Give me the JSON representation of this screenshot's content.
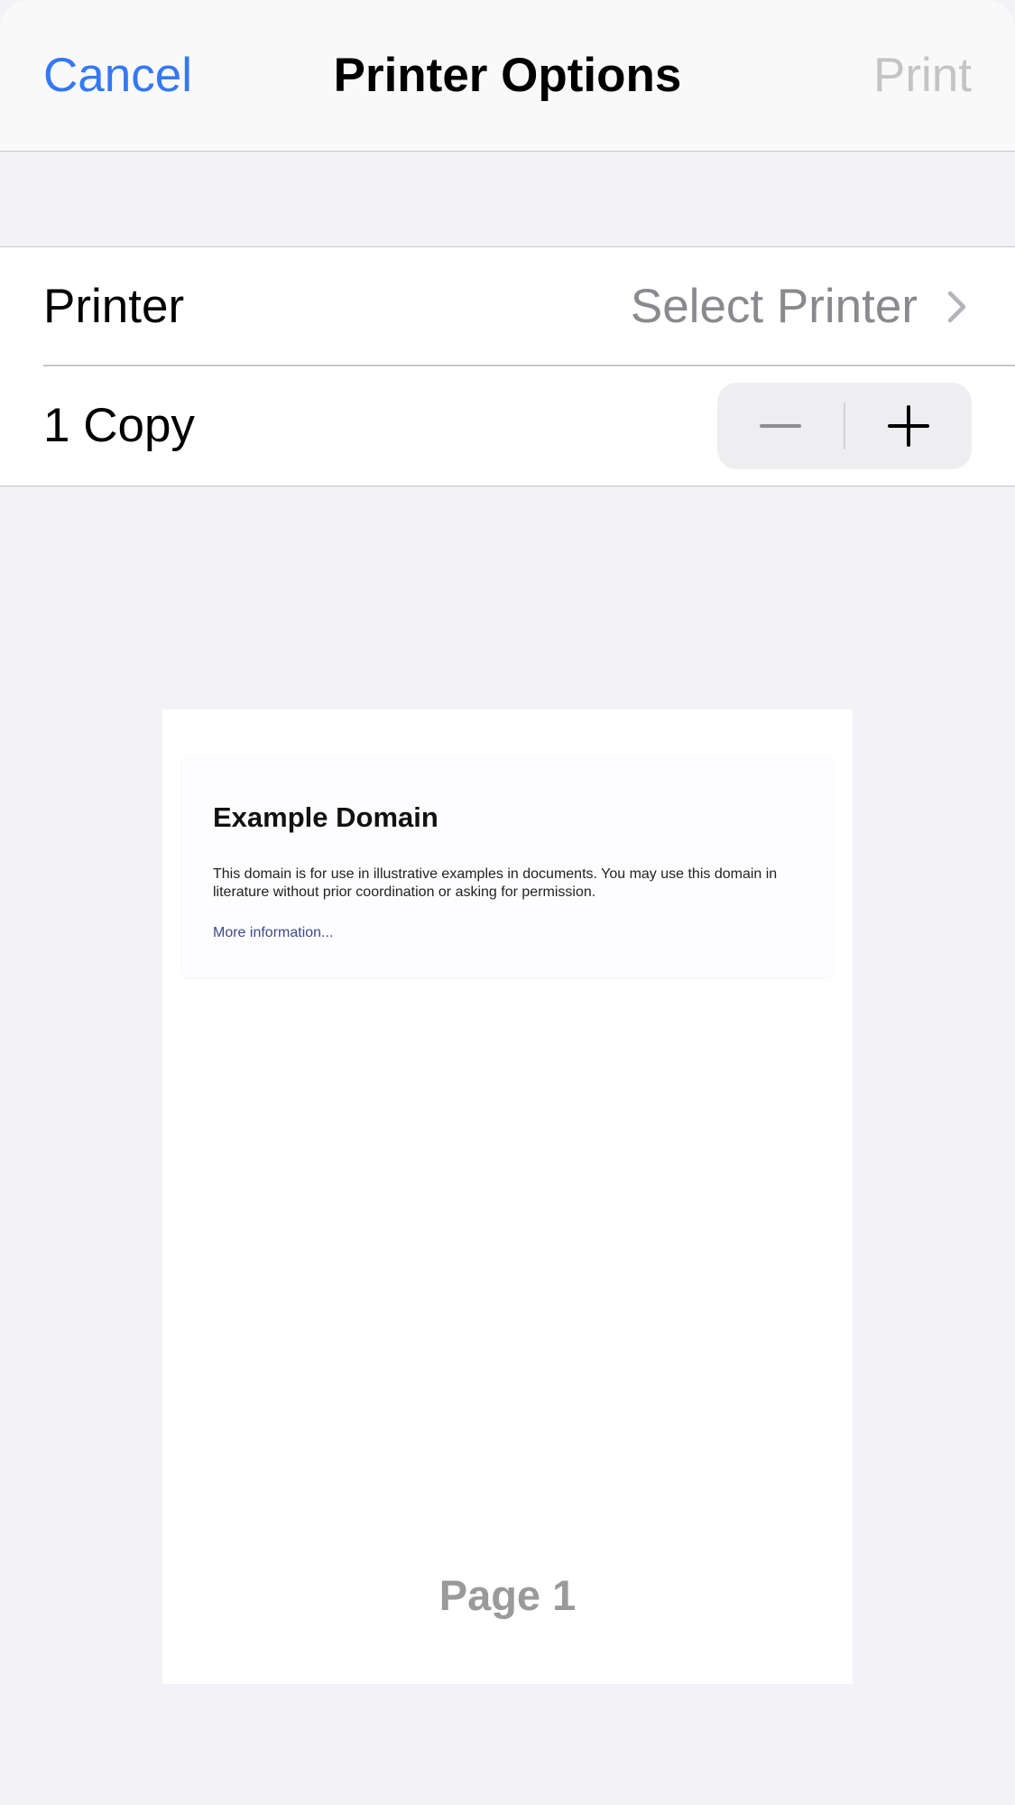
{
  "nav": {
    "cancel_label": "Cancel",
    "title": "Printer Options",
    "print_label": "Print"
  },
  "settings": {
    "printer": {
      "label": "Printer",
      "value": "Select Printer"
    },
    "copies": {
      "label": "1 Copy",
      "count": 1
    }
  },
  "preview": {
    "heading": "Example Domain",
    "body": "This domain is for use in illustrative examples in documents. You may use this domain in literature without prior coordination or asking for permission.",
    "link": "More information...",
    "page_label": "Page 1"
  },
  "colors": {
    "accent": "#3478f6",
    "disabled": "#c4c4c6",
    "secondary_text": "#8a8a8e",
    "background": "#f2f2f7"
  },
  "icons": {
    "chevron": "chevron-right-icon",
    "minus": "minus-icon",
    "plus": "plus-icon"
  }
}
